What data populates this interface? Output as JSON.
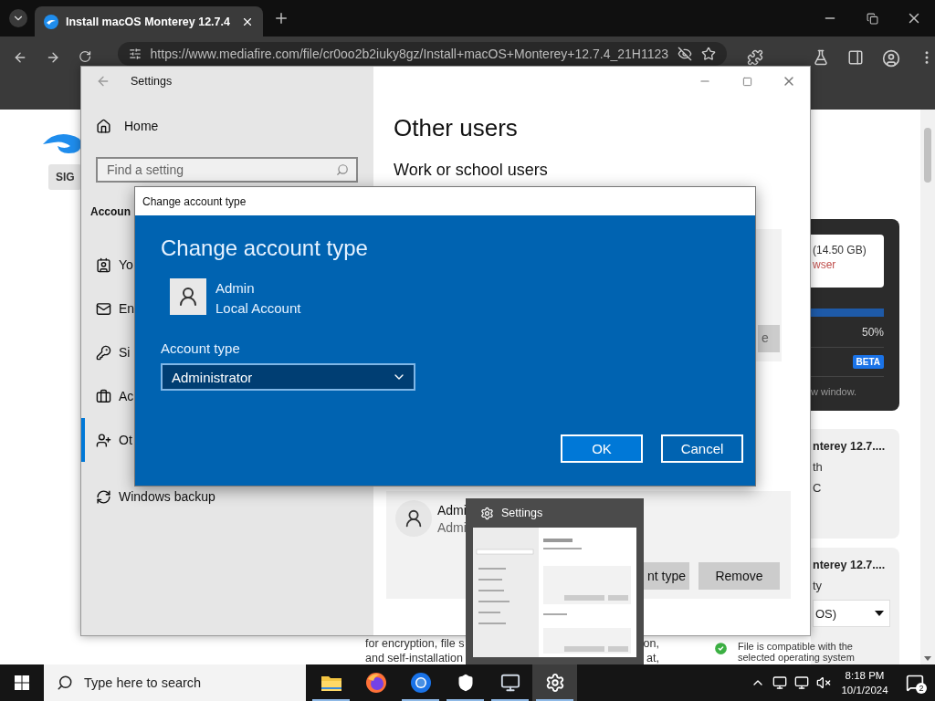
{
  "browser": {
    "tab_title": "Install macOS Monterey 12.7.4",
    "url": "https://www.mediafire.com/file/cr0oo2b2iuky8gz/Install+macOS+Monterey+12.7.4_21H1123"
  },
  "web_page": {
    "signup_button": "SIG",
    "download_card": {
      "size": "(14.50 GB)",
      "warning": "wser",
      "progress": {
        "level": 1
      },
      "percent": "50%",
      "badge": "BETA",
      "note": "w window."
    },
    "file_cards": [
      {
        "title": "nterey 12.7....",
        "lines": [
          "th",
          "C"
        ]
      },
      {
        "title": "nterey 12.7....",
        "lines": [
          "ty"
        ],
        "select": "OS)"
      }
    ],
    "body_lines": [
      [
        "for encryption, file s",
        "on,"
      ],
      [
        "and self-installation",
        "at,"
      ]
    ],
    "compat_note": "File is compatible with the selected operating system"
  },
  "settings": {
    "title": "Settings",
    "home": "Home",
    "search_placeholder": "Find a setting",
    "section": "Accoun",
    "nav": [
      {
        "label": "Yo",
        "selected": false
      },
      {
        "label": "En",
        "selected": false
      },
      {
        "label": "Si",
        "selected": false
      },
      {
        "label": "Ac",
        "selected": false
      },
      {
        "label": "Ot",
        "selected": true
      },
      {
        "label": "Windows backup",
        "selected": false
      }
    ],
    "heading": "Other users",
    "subheading": "Work or school users",
    "card_button": "e",
    "user": {
      "name": "Admi",
      "detail": "Admi"
    },
    "user_buttons": [
      "nt type",
      "Remove"
    ]
  },
  "dialog": {
    "title": "Change account type",
    "heading": "Change account type",
    "user_name": "Admin",
    "user_type": "Local Account",
    "field_label": "Account type",
    "value": "Administrator",
    "buttons": [
      {
        "label": "OK",
        "focused": true
      },
      {
        "label": "Cancel",
        "focused": false
      }
    ]
  },
  "thumbnail": {
    "title": "Settings"
  },
  "taskbar": {
    "search_placeholder": "Type here to search",
    "apps": [
      {
        "running": true,
        "selected": false
      },
      {
        "running": false,
        "selected": false
      },
      {
        "running": true,
        "selected": false
      },
      {
        "running": true,
        "selected": false
      },
      {
        "running": true,
        "selected": false
      },
      {
        "running": true,
        "selected": true
      }
    ],
    "time": "8:18 PM",
    "date": "10/1/2024",
    "notifications": "2"
  }
}
